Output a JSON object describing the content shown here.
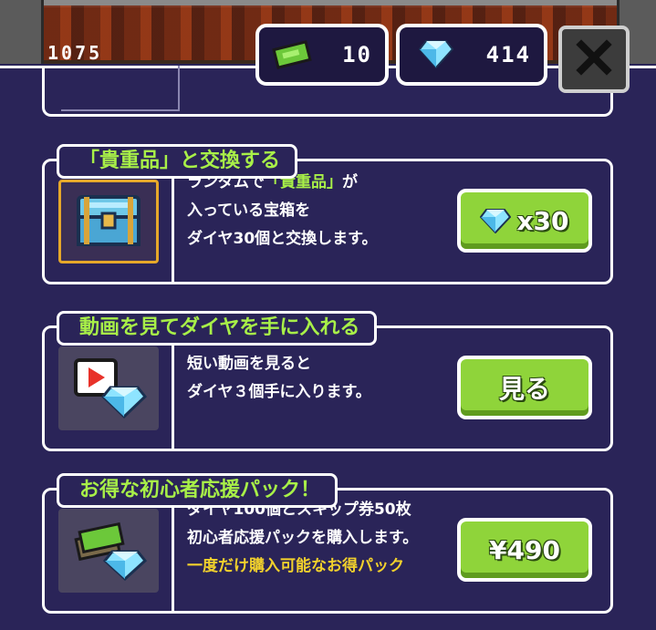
{
  "hud": {
    "scene_counter": "1075",
    "tickets": "10",
    "diamonds": "414"
  },
  "cards": [
    {
      "title": "「貴重品」と交換する",
      "desc_parts": [
        "ランダムで",
        "「貴重品」",
        "が",
        "入っている宝箱を",
        "ダイヤ30個と交換します。"
      ],
      "button_label": "x30"
    },
    {
      "title": "動画を見てダイヤを手に入れる",
      "desc_lines": [
        "短い動画を見ると",
        "ダイヤ３個手に入ります。"
      ],
      "button_label": "見る"
    },
    {
      "title": "お得な初心者応援パック！",
      "desc_lines": [
        "ダイヤ100個とスキップ券50枚",
        "初心者応援パックを購入します。"
      ],
      "desc_note": "一度だけ購入可能なお得パック",
      "button_label": "¥490"
    }
  ],
  "colors": {
    "panel_bg": "#2a2458",
    "title_green": "#a8f048",
    "button_green": "#8fd43a",
    "note_yellow": "#f2d12c"
  },
  "icons": [
    "ticket-icon",
    "diamond-icon",
    "close-icon",
    "treasure-chest-icon",
    "video-play-icon",
    "ticket-bundle-icon"
  ]
}
